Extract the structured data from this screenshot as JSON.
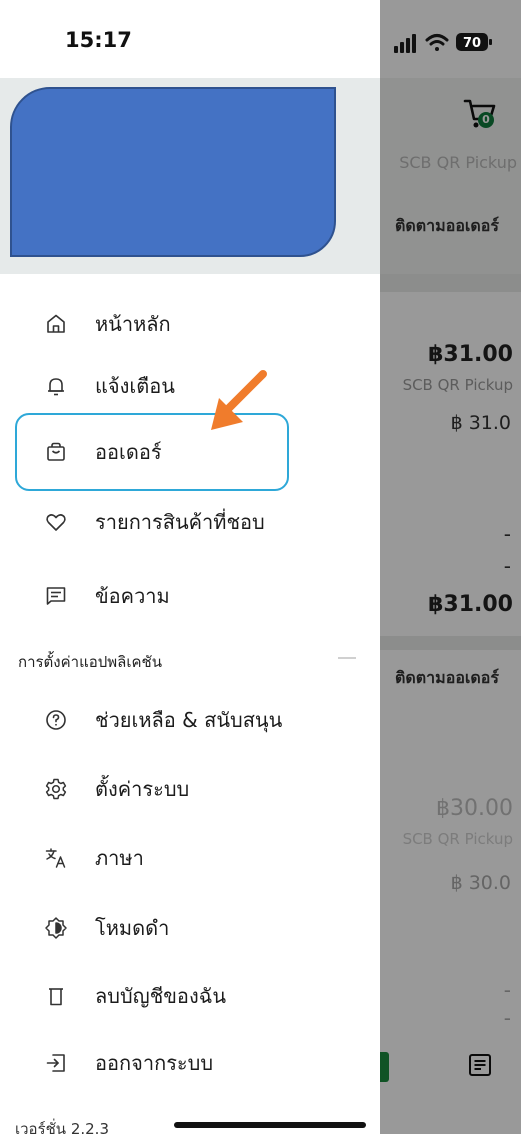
{
  "status_bar": {
    "time": "15:17",
    "battery": "70"
  },
  "background": {
    "cart_badge": "0",
    "store_name": "SCB QR Pickup",
    "tab_label": "ติดตามออเดอร์",
    "orders": [
      {
        "amount": "฿31.00",
        "pickup": "SCB QR Pickup",
        "price": "฿ 31.0",
        "dash1": "-",
        "dash2": "-",
        "total": "฿31.00",
        "track": "ติดตามออเดอร์"
      },
      {
        "amount": "฿30.00",
        "pickup": "SCB QR Pickup",
        "price": "฿ 30.0",
        "dash1": "-",
        "dash2": "-"
      }
    ]
  },
  "drawer": {
    "menu": [
      {
        "label": "หน้าหลัก",
        "icon": "home-icon"
      },
      {
        "label": "แจ้งเตือน",
        "icon": "bell-icon"
      },
      {
        "label": "ออเดอร์",
        "icon": "shopping-bag-icon"
      },
      {
        "label": "รายการสินค้าที่ชอบ",
        "icon": "heart-icon"
      },
      {
        "label": "ข้อความ",
        "icon": "message-icon"
      }
    ],
    "settings_section": "การตั้งค่าแอปพลิเคชัน",
    "settings": [
      {
        "label": "ช่วยเหลือ & สนับสนุน",
        "icon": "help-icon"
      },
      {
        "label": "ตั้งค่าระบบ",
        "icon": "gear-icon"
      },
      {
        "label": "ภาษา",
        "icon": "translate-icon"
      },
      {
        "label": "โหมดดำ",
        "icon": "dark-mode-icon"
      },
      {
        "label": "ลบบัญชีของฉัน",
        "icon": "trash-icon"
      },
      {
        "label": "ออกจากระบบ",
        "icon": "logout-icon"
      }
    ],
    "version": "เวอร์ชั่น 2.2.3"
  },
  "colors": {
    "highlight": "#2ea8d8",
    "arrow": "#f07c2c",
    "redaction": "#4472c4",
    "brand_green": "#0f7a3d"
  }
}
